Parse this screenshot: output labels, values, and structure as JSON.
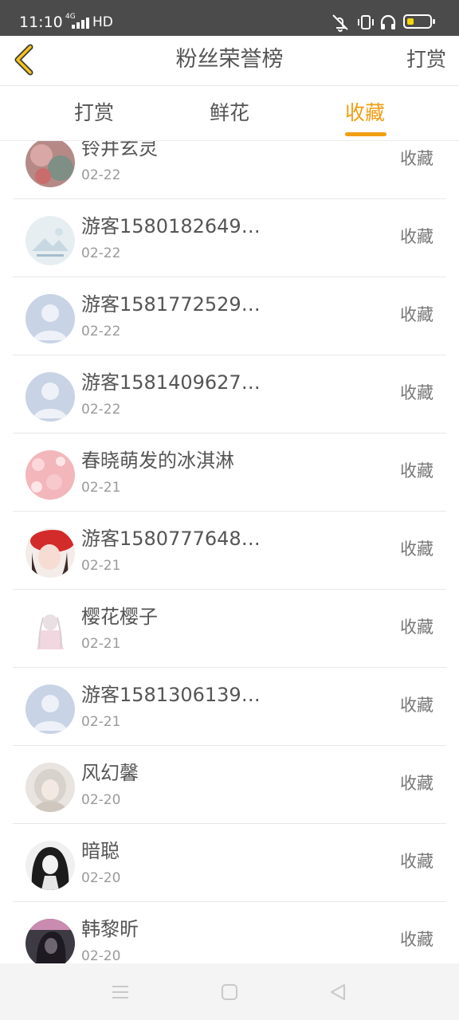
{
  "status_bar": {
    "time": "11:10",
    "network": "4G",
    "hd": "HD",
    "icons": [
      "mute-icon",
      "vibrate-icon",
      "headphone-icon",
      "battery-icon"
    ],
    "battery_color": "#f4d60b"
  },
  "header": {
    "title": "粉丝荣誉榜",
    "right_action": "打赏",
    "accent": "#f29d12"
  },
  "tabs": [
    {
      "label": "打赏",
      "active": false
    },
    {
      "label": "鲜花",
      "active": false
    },
    {
      "label": "收藏",
      "active": true
    }
  ],
  "list": [
    {
      "name": "铃井玄灵",
      "date": "02-22",
      "action": "收藏",
      "avatar": "photo"
    },
    {
      "name": "游客1580182649…",
      "date": "02-22",
      "action": "收藏",
      "avatar": "landscape"
    },
    {
      "name": "游客1581772529…",
      "date": "02-22",
      "action": "收藏",
      "avatar": "default"
    },
    {
      "name": "游客1581409627…",
      "date": "02-22",
      "action": "收藏",
      "avatar": "default"
    },
    {
      "name": "春晓萌发的冰淇淋",
      "date": "02-21",
      "action": "收藏",
      "avatar": "photo"
    },
    {
      "name": "游客1580777648…",
      "date": "02-21",
      "action": "收藏",
      "avatar": "photo"
    },
    {
      "name": "樱花樱子",
      "date": "02-21",
      "action": "收藏",
      "avatar": "photo"
    },
    {
      "name": "游客1581306139…",
      "date": "02-21",
      "action": "收藏",
      "avatar": "default"
    },
    {
      "name": "风幻馨",
      "date": "02-20",
      "action": "收藏",
      "avatar": "photo"
    },
    {
      "name": "暗聪",
      "date": "02-20",
      "action": "收藏",
      "avatar": "photo"
    },
    {
      "name": "韩黎昕",
      "date": "02-20",
      "action": "收藏",
      "avatar": "photo"
    }
  ],
  "nav_bar": {
    "buttons": [
      "menu-icon",
      "home-icon",
      "back-icon"
    ]
  }
}
